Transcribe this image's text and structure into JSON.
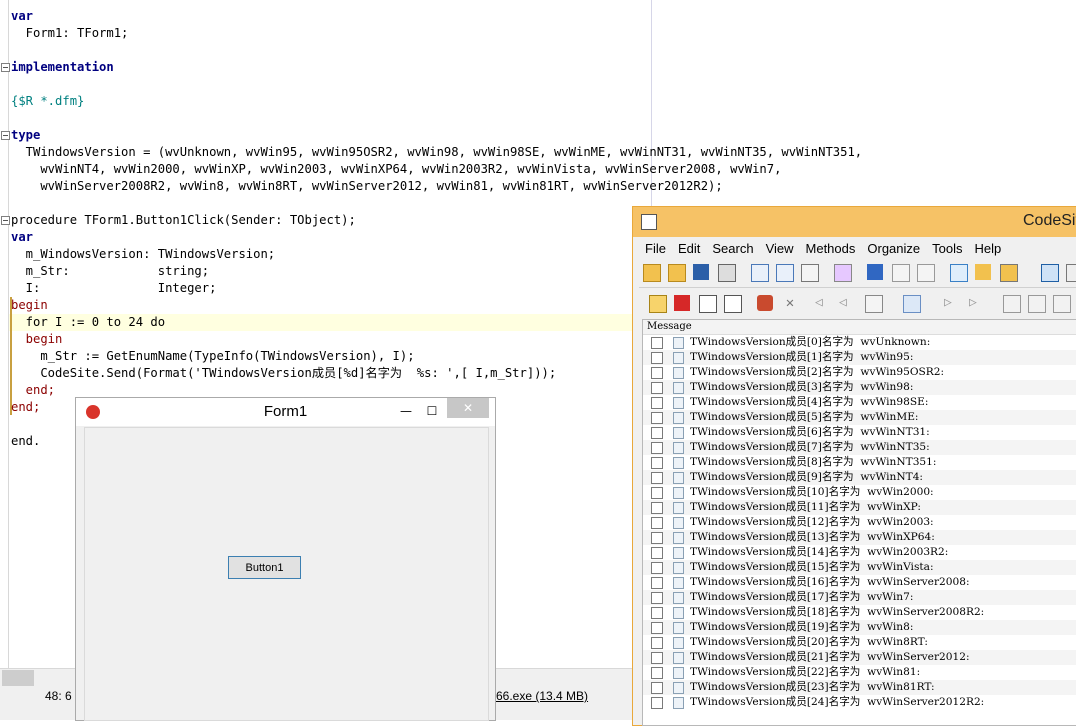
{
  "editor": {
    "lines": [
      "var",
      "  Form1: TForm1;",
      "",
      "implementation",
      "",
      "{$R *.dfm}",
      "",
      "type",
      "  TWindowsVersion = (wvUnknown, wvWin95, wvWin95OSR2, wvWin98, wvWin98SE, wvWinME, wvWinNT31, wvWinNT35, wvWinNT351,",
      "    wvWinNT4, wvWin2000, wvWinXP, wvWin2003, wvWinXP64, wvWin2003R2, wvWinVista, wvWinServer2008, wvWin7,",
      "    wvWinServer2008R2, wvWin8, wvWin8RT, wvWinServer2012, wvWin81, wvWin81RT, wvWinServer2012R2);",
      "",
      "procedure TForm1.Button1Click(Sender: TObject);",
      "var",
      "  m_WindowsVersion: TWindowsVersion;",
      "  m_Str:            string;",
      "  I:                Integer;",
      "begin",
      "  for I := 0 to 24 do",
      "  begin",
      "    m_Str := GetEnumName(TypeInfo(TWindowsVersion), I);",
      "    CodeSite.Send(Format('TWindowsVersion成员[%d]名字为  %s: ',[ I,m_Str]));",
      "  end;",
      "end;",
      "",
      "end."
    ],
    "status_position": "48: 6",
    "status_file": "66.exe (13.4 MB)"
  },
  "form1": {
    "title": "Form1",
    "minimize": "—",
    "maximize": "☐",
    "close": "✕",
    "button_label": "Button1"
  },
  "codesite": {
    "title": "CodeSit",
    "menu": [
      "File",
      "Edit",
      "Search",
      "View",
      "Methods",
      "Organize",
      "Tools",
      "Help"
    ],
    "column_header": "Message",
    "messages": [
      "TWindowsVersion成员[0]名字为  wvUnknown:",
      "TWindowsVersion成员[1]名字为  wvWin95:",
      "TWindowsVersion成员[2]名字为  wvWin95OSR2:",
      "TWindowsVersion成员[3]名字为  wvWin98:",
      "TWindowsVersion成员[4]名字为  wvWin98SE:",
      "TWindowsVersion成员[5]名字为  wvWinME:",
      "TWindowsVersion成员[6]名字为  wvWinNT31:",
      "TWindowsVersion成员[7]名字为  wvWinNT35:",
      "TWindowsVersion成员[8]名字为  wvWinNT351:",
      "TWindowsVersion成员[9]名字为  wvWinNT4:",
      "TWindowsVersion成员[10]名字为  wvWin2000:",
      "TWindowsVersion成员[11]名字为  wvWinXP:",
      "TWindowsVersion成员[12]名字为  wvWin2003:",
      "TWindowsVersion成员[13]名字为  wvWinXP64:",
      "TWindowsVersion成员[14]名字为  wvWin2003R2:",
      "TWindowsVersion成员[15]名字为  wvWinVista:",
      "TWindowsVersion成员[16]名字为  wvWinServer2008:",
      "TWindowsVersion成员[17]名字为  wvWin7:",
      "TWindowsVersion成员[18]名字为  wvWinServer2008R2:",
      "TWindowsVersion成员[19]名字为  wvWin8:",
      "TWindowsVersion成员[20]名字为  wvWin8RT:",
      "TWindowsVersion成员[21]名字为  wvWinServer2012:",
      "TWindowsVersion成员[22]名字为  wvWin81:",
      "TWindowsVersion成员[23]名字为  wvWin81RT:",
      "TWindowsVersion成员[24]名字为  wvWinServer2012R2:"
    ]
  },
  "colors": {
    "codesite_title": "#f6c266",
    "current_line": "#ffffe0",
    "keyword": "#000080",
    "string": "#0000ff"
  }
}
